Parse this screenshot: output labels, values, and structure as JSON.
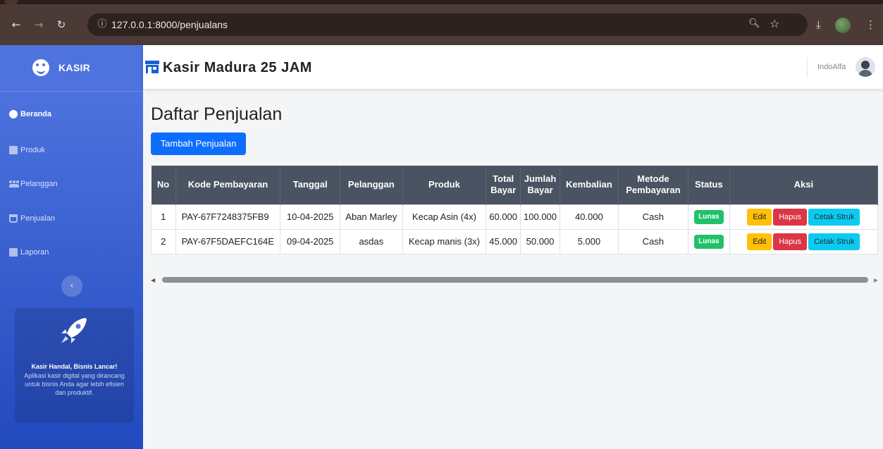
{
  "browser": {
    "url": "127.0.0.1:8000/penjualans"
  },
  "sidebar": {
    "brand": "KASIR",
    "items": [
      {
        "label": "Beranda",
        "icon": "dashboard-icon",
        "active": true
      },
      {
        "label": "Produk",
        "icon": "box-icon"
      },
      {
        "label": "Pelanggan",
        "icon": "users-icon"
      },
      {
        "label": "Penjualan",
        "icon": "cart-icon"
      },
      {
        "label": "Laporan",
        "icon": "report-icon"
      }
    ],
    "collapse_icon": "chevron-left-icon",
    "promo": {
      "title": "Kasir Handal, Bisnis Lancar!",
      "text": "Aplikasi kasir digital yang dirancang untuk bisnis Anda agar lebih efisien dan produktif."
    }
  },
  "topbar": {
    "title": "Kasir Madura 25 JAM",
    "user_name": "IndoAlfa"
  },
  "page": {
    "heading": "Daftar Penjualan",
    "add_button": "Tambah Penjualan"
  },
  "table": {
    "headers": [
      "No",
      "Kode Pembayaran",
      "Tanggal",
      "Pelanggan",
      "Produk",
      "Total Bayar",
      "Jumlah Bayar",
      "Kembalian",
      "Metode Pembayaran",
      "Status",
      "Aksi"
    ],
    "rows": [
      {
        "no": "1",
        "kode": "PAY-67F7248375FB9",
        "tanggal": "10-04-2025",
        "pelanggan": "Aban Marley",
        "produk": "Kecap Asin (4x)",
        "total": "60.000",
        "jumlah": "100.000",
        "kembalian": "40.000",
        "metode": "Cash",
        "status": "Lunas"
      },
      {
        "no": "2",
        "kode": "PAY-67F5DAEFC164E",
        "tanggal": "09-04-2025",
        "pelanggan": "asdas",
        "produk": "Kecap manis (3x)",
        "total": "45.000",
        "jumlah": "50.000",
        "kembalian": "5.000",
        "metode": "Cash",
        "status": "Lunas"
      }
    ],
    "actions": {
      "edit": "Edit",
      "hapus": "Hapus",
      "cetak": "Cetak Struk"
    }
  },
  "colors": {
    "sidebar_top": "#4e73df",
    "sidebar_bottom": "#224abe",
    "primary_button": "#0d6efd",
    "table_header": "#4a5361",
    "status_badge": "#20c16a",
    "edit": "#ffc107",
    "hapus": "#dc3545",
    "cetak": "#0dcaf0"
  }
}
